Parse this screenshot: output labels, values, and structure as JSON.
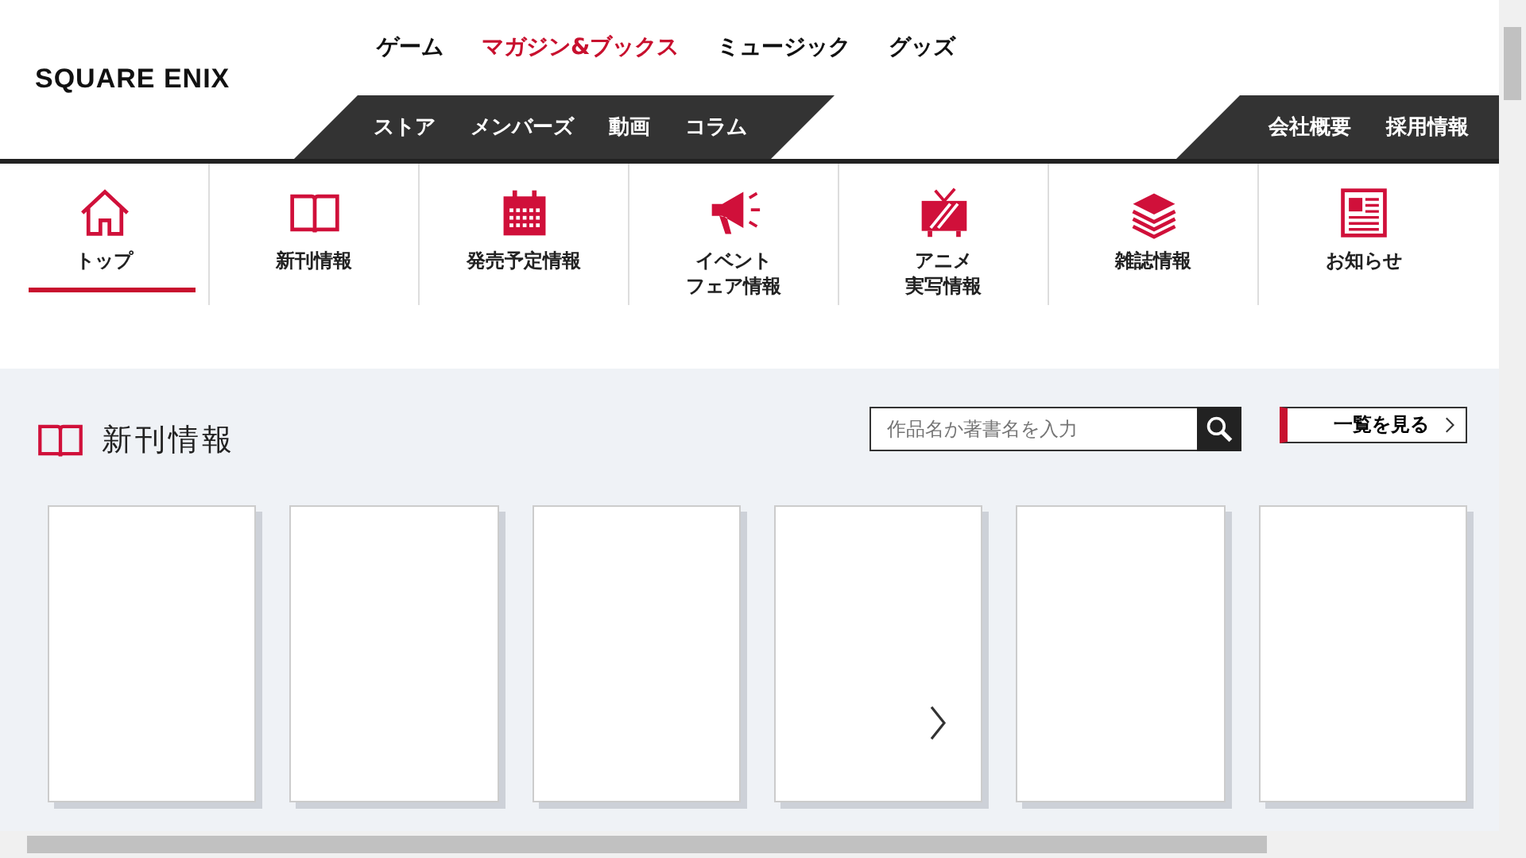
{
  "logo": "SQUARE ENIX",
  "top_nav": [
    {
      "label": "ゲーム",
      "selected": false
    },
    {
      "label": "マガジン&ブックス",
      "selected": true
    },
    {
      "label": "ミュージック",
      "selected": false
    },
    {
      "label": "グッズ",
      "selected": false
    }
  ],
  "sub_nav": [
    "ストア",
    "メンバーズ",
    "動画",
    "コラム"
  ],
  "corporate_nav": [
    "会社概要",
    "採用情報"
  ],
  "categories": [
    {
      "label": "トップ",
      "kind": "home",
      "selected": true
    },
    {
      "label": "新刊情報",
      "kind": "book",
      "selected": false
    },
    {
      "label": "発売予定情報",
      "kind": "calendar",
      "selected": false
    },
    {
      "lines": [
        "イベント",
        "フェア情報"
      ],
      "kind": "megaphone",
      "selected": false
    },
    {
      "lines": [
        "アニメ",
        "実写情報"
      ],
      "kind": "tv",
      "selected": false
    },
    {
      "label": "雑誌情報",
      "kind": "books",
      "selected": false
    },
    {
      "label": "お知らせ",
      "kind": "news",
      "selected": false
    }
  ],
  "section": {
    "title": "新刊情報",
    "search": {
      "placeholder": "作品名か著書名を入力"
    },
    "view_all": "一覧を見る"
  }
}
